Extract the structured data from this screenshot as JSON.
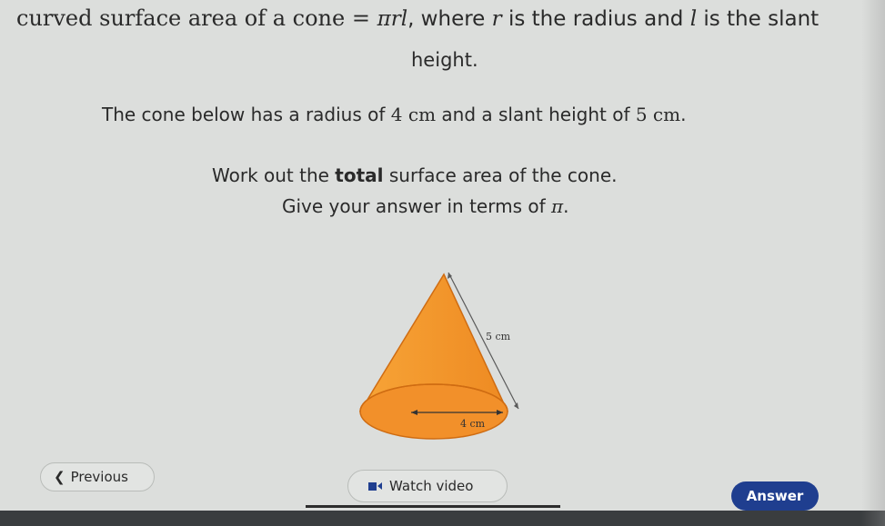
{
  "question": {
    "line1_bold": "curved surface area of a cone",
    "line1_eq": " = ",
    "line1_formula": "πrl",
    "line1_rest": ", where ",
    "line1_r": "r",
    "line1_mid": " is the radius and ",
    "line1_l": "l",
    "line1_end": " is the slant",
    "line2": "height.",
    "line3_a": "The cone below has a radius of ",
    "line3_r": "4 cm",
    "line3_b": " and a slant height of ",
    "line3_l": "5 cm",
    "line3_end": ".",
    "line4_a": "Work out the ",
    "line4_bold": "total",
    "line4_b": " surface area of the cone.",
    "line5_a": "Give your answer in terms of ",
    "line5_pi": "π",
    "line5_end": "."
  },
  "diagram": {
    "slant_label": "5 cm",
    "radius_label": "4 cm",
    "fill_color": "#f39a2b",
    "base_color": "#f08a1f",
    "stroke_color": "#d06a10"
  },
  "nav": {
    "previous_label": "Previous",
    "previous_icon": "chevron-left-icon",
    "video_label": "Watch video",
    "video_icon": "video-camera-icon",
    "answer_label": "Answer",
    "answer_color": "#1f3e8f"
  }
}
